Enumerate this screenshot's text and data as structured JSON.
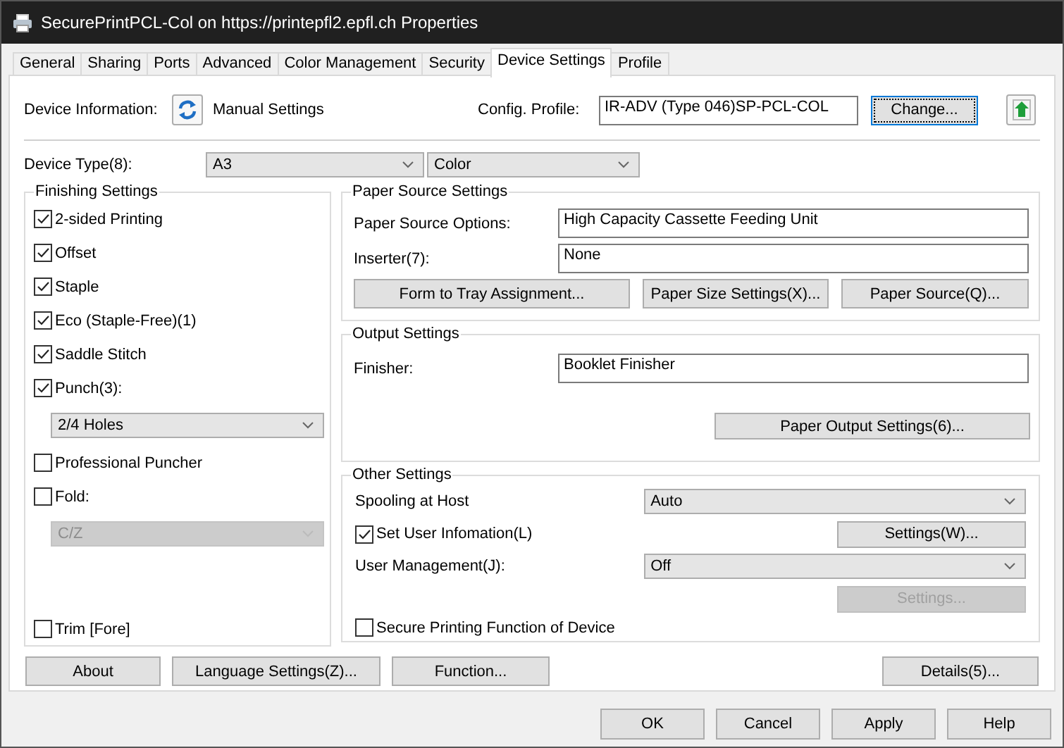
{
  "window": {
    "title": "SecurePrintPCL-Col on https://printepfl2.epfl.ch Properties"
  },
  "tabs": [
    {
      "label": "General",
      "selected": false
    },
    {
      "label": "Sharing",
      "selected": false
    },
    {
      "label": "Ports",
      "selected": false
    },
    {
      "label": "Advanced",
      "selected": false
    },
    {
      "label": "Color Management",
      "selected": false
    },
    {
      "label": "Security",
      "selected": false
    },
    {
      "label": "Device Settings",
      "selected": true
    },
    {
      "label": "Profile",
      "selected": false
    }
  ],
  "device_information": {
    "label": "Device Information:",
    "value": "Manual Settings",
    "config_profile_label": "Config. Profile:",
    "config_profile_value": "IR-ADV (Type 046)SP-PCL-COL",
    "change_button": "Change..."
  },
  "device_type": {
    "label": "Device Type(8):",
    "size": "A3",
    "color_mode": "Color"
  },
  "finishing_settings": {
    "title": "Finishing Settings",
    "items": [
      {
        "kind": "checkbox",
        "label": "2-sided Printing",
        "checked": true
      },
      {
        "kind": "checkbox",
        "label": "Offset",
        "checked": true
      },
      {
        "kind": "checkbox",
        "label": "Staple",
        "checked": true
      },
      {
        "kind": "checkbox",
        "label": "Eco (Staple-Free)(1)",
        "checked": true
      },
      {
        "kind": "checkbox",
        "label": "Saddle Stitch",
        "checked": true
      },
      {
        "kind": "checkbox",
        "label": "Punch(3):",
        "checked": true
      },
      {
        "kind": "dropdown",
        "value": "2/4 Holes",
        "disabled": false
      },
      {
        "kind": "checkbox",
        "label": "Professional Puncher",
        "checked": false
      },
      {
        "kind": "checkbox",
        "label": "Fold:",
        "checked": false
      },
      {
        "kind": "dropdown",
        "value": "C/Z",
        "disabled": true
      }
    ],
    "bottom_items": [
      {
        "kind": "checkbox",
        "label": "Trim [Fore]",
        "checked": false
      }
    ]
  },
  "paper_source_settings": {
    "title": "Paper Source Settings",
    "fields": [
      {
        "label": "Paper Source Options:",
        "value": "High Capacity Cassette Feeding Unit"
      },
      {
        "label": "Inserter(7):",
        "value": "None"
      }
    ],
    "buttons": [
      "Form to Tray Assignment...",
      "Paper Size Settings(X)...",
      "Paper Source(Q)..."
    ]
  },
  "output_settings": {
    "title": "Output Settings",
    "fields": [
      {
        "label": "Finisher:",
        "value": "Booklet Finisher"
      }
    ],
    "buttons": [
      "Paper Output Settings(6)..."
    ]
  },
  "other_settings": {
    "title": "Other Settings",
    "rows": [
      {
        "kind": "dropdown",
        "label": "Spooling at Host",
        "value": "Auto"
      },
      {
        "kind": "checkbox",
        "label": "Set User Infomation(L)",
        "checked": true,
        "button": "Settings(W)...",
        "disabled": false
      },
      {
        "kind": "dropdown",
        "label": "User Management(J):",
        "value": "Off"
      },
      {
        "kind": "button",
        "button": "Settings...",
        "disabled": true
      },
      {
        "kind": "checkbox",
        "label": "Secure Printing Function of Device",
        "checked": false
      }
    ]
  },
  "bottom_buttons": {
    "left": [
      "About",
      "Language Settings(Z)...",
      "Function..."
    ],
    "right": [
      "Details(5)..."
    ]
  },
  "dialog_buttons": [
    "OK",
    "Cancel",
    "Apply",
    "Help"
  ]
}
